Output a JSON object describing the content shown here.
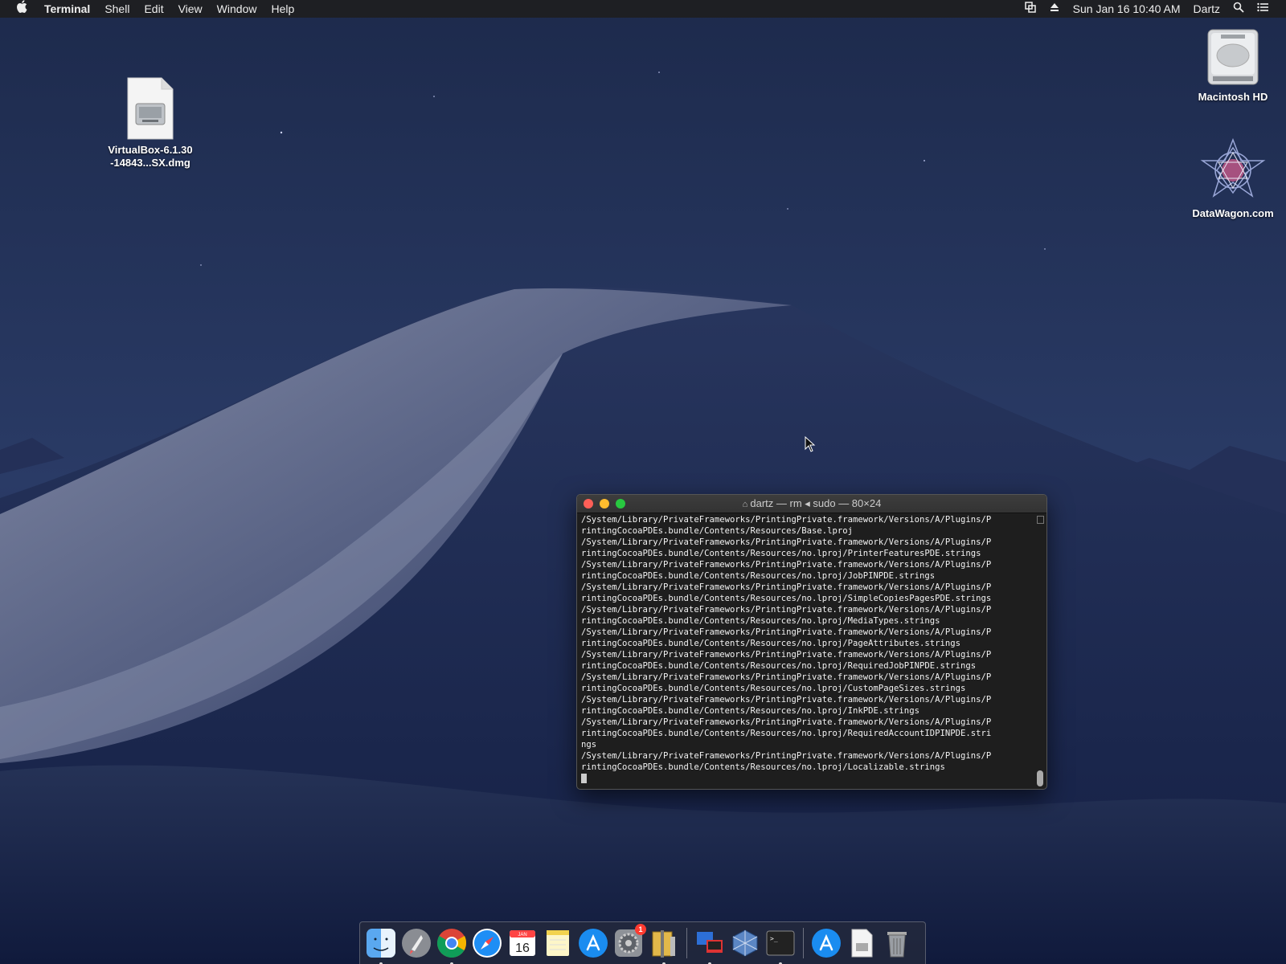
{
  "menubar": {
    "app_name": "Terminal",
    "menus": [
      "Shell",
      "Edit",
      "View",
      "Window",
      "Help"
    ],
    "clock": "Sun Jan 16  10:40 AM",
    "user": "Dartz"
  },
  "desktop_icons": {
    "dmg": {
      "label_line1": "VirtualBox-6.1.30",
      "label_line2": "-14843...SX.dmg"
    },
    "hd": {
      "label": "Macintosh HD"
    },
    "datawagon": {
      "label": "DataWagon.com"
    }
  },
  "terminal": {
    "title": "dartz — rm ◂ sudo — 80×24",
    "lines": [
      "/System/Library/PrivateFrameworks/PrintingPrivate.framework/Versions/A/Plugins/P",
      "rintingCocoaPDEs.bundle/Contents/Resources/Base.lproj",
      "/System/Library/PrivateFrameworks/PrintingPrivate.framework/Versions/A/Plugins/P",
      "rintingCocoaPDEs.bundle/Contents/Resources/no.lproj/PrinterFeaturesPDE.strings",
      "/System/Library/PrivateFrameworks/PrintingPrivate.framework/Versions/A/Plugins/P",
      "rintingCocoaPDEs.bundle/Contents/Resources/no.lproj/JobPINPDE.strings",
      "/System/Library/PrivateFrameworks/PrintingPrivate.framework/Versions/A/Plugins/P",
      "rintingCocoaPDEs.bundle/Contents/Resources/no.lproj/SimpleCopiesPagesPDE.strings",
      "/System/Library/PrivateFrameworks/PrintingPrivate.framework/Versions/A/Plugins/P",
      "rintingCocoaPDEs.bundle/Contents/Resources/no.lproj/MediaTypes.strings",
      "/System/Library/PrivateFrameworks/PrintingPrivate.framework/Versions/A/Plugins/P",
      "rintingCocoaPDEs.bundle/Contents/Resources/no.lproj/PageAttributes.strings",
      "/System/Library/PrivateFrameworks/PrintingPrivate.framework/Versions/A/Plugins/P",
      "rintingCocoaPDEs.bundle/Contents/Resources/no.lproj/RequiredJobPINPDE.strings",
      "/System/Library/PrivateFrameworks/PrintingPrivate.framework/Versions/A/Plugins/P",
      "rintingCocoaPDEs.bundle/Contents/Resources/no.lproj/CustomPageSizes.strings",
      "/System/Library/PrivateFrameworks/PrintingPrivate.framework/Versions/A/Plugins/P",
      "rintingCocoaPDEs.bundle/Contents/Resources/no.lproj/InkPDE.strings",
      "/System/Library/PrivateFrameworks/PrintingPrivate.framework/Versions/A/Plugins/P",
      "rintingCocoaPDEs.bundle/Contents/Resources/no.lproj/RequiredAccountIDPINPDE.stri",
      "ngs",
      "/System/Library/PrivateFrameworks/PrintingPrivate.framework/Versions/A/Plugins/P",
      "rintingCocoaPDEs.bundle/Contents/Resources/no.lproj/Localizable.strings"
    ]
  },
  "dock": {
    "calendar_month": "JAN",
    "calendar_day": "16",
    "system_prefs_badge": "1",
    "items": [
      "finder-icon",
      "launchpad-icon",
      "chrome-icon",
      "safari-icon",
      "calendar-icon",
      "notes-icon",
      "app-store-icon",
      "system-preferences-icon",
      "archive-utility-icon",
      "remote-desktop-icon",
      "virtualbox-icon",
      "terminal-icon",
      "downloads-icon",
      "documents-icon",
      "trash-icon"
    ]
  },
  "colors": {
    "menubar_bg": "#1e1e20",
    "terminal_bg": "#1e1e1e",
    "close": "#ff5f57",
    "minimize": "#febc2e",
    "maximize": "#28c840"
  }
}
